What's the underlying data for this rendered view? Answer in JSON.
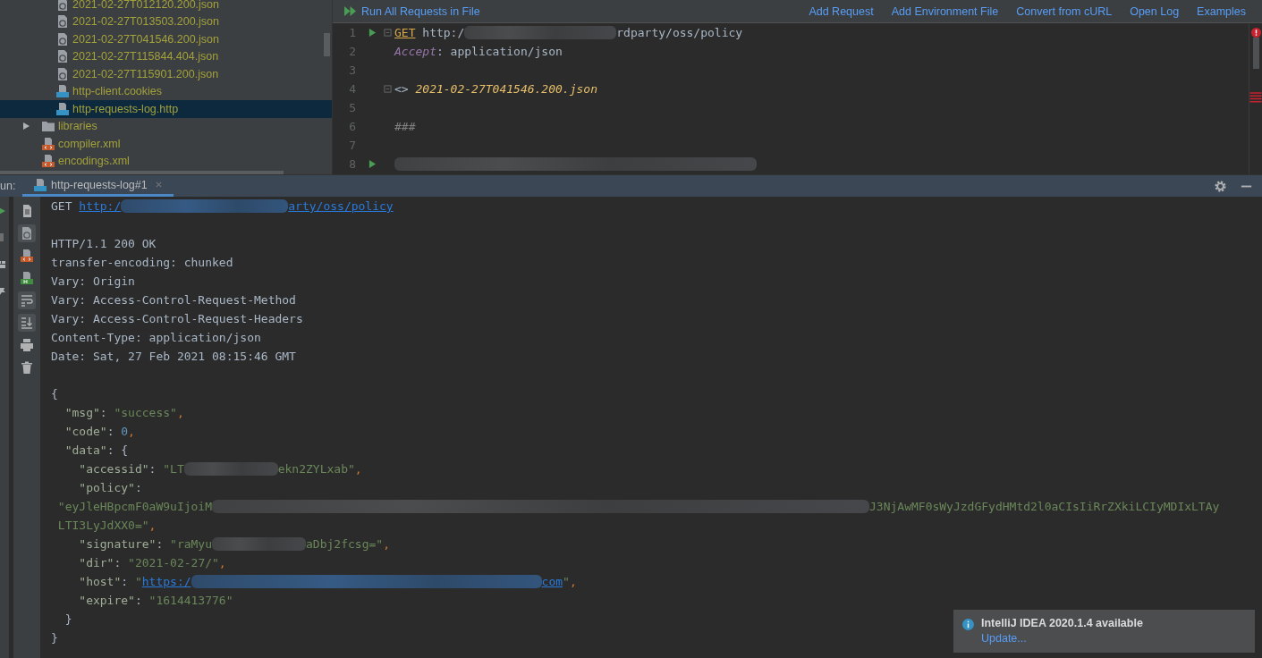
{
  "project_tree": {
    "items": [
      {
        "children": [
          {
            "label": "2021-02-27T012120.200.json",
            "kind": "json",
            "selected": false
          },
          {
            "label": "2021-02-27T013503.200.json",
            "kind": "json",
            "selected": false
          },
          {
            "label": "2021-02-27T041546.200.json",
            "kind": "json",
            "selected": false
          },
          {
            "label": "2021-02-27T115844.404.json",
            "kind": "json",
            "selected": false
          },
          {
            "label": "2021-02-27T115901.200.json",
            "kind": "json",
            "selected": false
          },
          {
            "label": "http-client.cookies",
            "kind": "api",
            "selected": false
          },
          {
            "label": "http-requests-log.http",
            "kind": "api",
            "selected": true
          }
        ]
      },
      {
        "label": "libraries",
        "kind": "folder",
        "expanded": false,
        "selected": false
      },
      {
        "label": "compiler.xml",
        "kind": "xml",
        "selected": false
      },
      {
        "label": "encodings.xml",
        "kind": "xml",
        "selected": false
      }
    ]
  },
  "editor": {
    "toolbar": {
      "run_all": "Run All Requests in File",
      "actions": [
        "Add Request",
        "Add Environment File",
        "Convert from cURL",
        "Open Log",
        "Examples"
      ]
    },
    "lines": [
      {
        "number": "1",
        "run": true,
        "fold": true,
        "tokens": [
          {
            "kind": "method",
            "text": "GET"
          },
          {
            "kind": "plain",
            "text": " http:/"
          },
          {
            "kind": "redacted"
          },
          {
            "kind": "plain",
            "text": "rdparty/oss/policy"
          }
        ]
      },
      {
        "number": "2",
        "run": false,
        "fold": false,
        "tokens": [
          {
            "kind": "header",
            "text": "Accept"
          },
          {
            "kind": "plain",
            "text": ": application/json"
          }
        ]
      },
      {
        "number": "3",
        "run": false,
        "fold": false
      },
      {
        "number": "4",
        "run": false,
        "fold": true,
        "tokens": [
          {
            "kind": "plain",
            "text": "<> "
          },
          {
            "kind": "ref",
            "text": "2021-02-27T041546.200.json"
          }
        ]
      },
      {
        "number": "5",
        "run": false,
        "fold": false
      },
      {
        "number": "6",
        "run": false,
        "fold": false,
        "tokens": [
          {
            "kind": "separator",
            "text": "###"
          }
        ]
      },
      {
        "number": "7",
        "run": false,
        "fold": false
      },
      {
        "number": "8",
        "run": true,
        "fold": false,
        "tokens": [
          {
            "kind": "redacted"
          }
        ]
      }
    ]
  },
  "run_panel": {
    "label": "un:",
    "tab": {
      "label": "http-requests-log#1",
      "selected": true
    },
    "output": [
      {
        "tokens": [
          {
            "kind": "plain",
            "text": "GET "
          },
          {
            "kind": "link",
            "text": "http:/"
          },
          {
            "kind": "redacted_link"
          },
          {
            "kind": "link",
            "text": "arty/oss/policy"
          }
        ]
      },
      {
        "kind": "blank"
      },
      {
        "tokens": [
          {
            "kind": "plain",
            "text": "HTTP/1.1 200 OK"
          }
        ]
      },
      {
        "tokens": [
          {
            "kind": "plain",
            "text": "transfer-encoding: chunked"
          }
        ]
      },
      {
        "tokens": [
          {
            "kind": "plain",
            "text": "Vary: Origin"
          }
        ]
      },
      {
        "tokens": [
          {
            "kind": "plain",
            "text": "Vary: Access-Control-Request-Method"
          }
        ]
      },
      {
        "tokens": [
          {
            "kind": "plain",
            "text": "Vary: Access-Control-Request-Headers"
          }
        ]
      },
      {
        "tokens": [
          {
            "kind": "plain",
            "text": "Content-Type: application/json"
          }
        ]
      },
      {
        "tokens": [
          {
            "kind": "plain",
            "text": "Date: Sat, 27 Feb 2021 08:15:46 GMT"
          }
        ]
      },
      {
        "kind": "blank"
      },
      {
        "tokens": [
          {
            "kind": "plain",
            "text": "{"
          }
        ]
      },
      {
        "tokens": [
          {
            "kind": "key",
            "text": "  \"msg\""
          },
          {
            "kind": "plain",
            "text": ": "
          },
          {
            "kind": "string",
            "text": "\"success\""
          },
          {
            "kind": "comma",
            "text": ","
          }
        ]
      },
      {
        "tokens": [
          {
            "kind": "key",
            "text": "  \"code\""
          },
          {
            "kind": "plain",
            "text": ": "
          },
          {
            "kind": "number",
            "text": "0"
          },
          {
            "kind": "comma",
            "text": ","
          }
        ]
      },
      {
        "tokens": [
          {
            "kind": "key",
            "text": "  \"data\""
          },
          {
            "kind": "plain",
            "text": ": {"
          }
        ]
      },
      {
        "tokens": [
          {
            "kind": "key",
            "text": "    \"accessid\""
          },
          {
            "kind": "plain",
            "text": ": "
          },
          {
            "kind": "string",
            "text": "\"LT"
          },
          {
            "kind": "redacted"
          },
          {
            "kind": "string",
            "text": "ekn2ZYLxab\""
          },
          {
            "kind": "comma",
            "text": ","
          }
        ]
      },
      {
        "tokens": [
          {
            "kind": "key",
            "text": "    \"policy\""
          },
          {
            "kind": "plain",
            "text": ":"
          }
        ]
      },
      {
        "tokens": [
          {
            "kind": "string",
            "text": " \"eyJleHBpcmF0aW9uIjoiM"
          },
          {
            "kind": "redacted_long"
          },
          {
            "kind": "string",
            "text": "J3NjAwMF0sWyJzdGFydHMtd2l0aCIsIiRrZXkiLCIyMDIxLTAy"
          }
        ]
      },
      {
        "tokens": [
          {
            "kind": "string",
            "text": " LTI3LyJdXX0=\""
          },
          {
            "kind": "comma",
            "text": ","
          }
        ]
      },
      {
        "tokens": [
          {
            "kind": "key",
            "text": "    \"signature\""
          },
          {
            "kind": "plain",
            "text": ": "
          },
          {
            "kind": "string",
            "text": "\"raMyu"
          },
          {
            "kind": "redacted"
          },
          {
            "kind": "string",
            "text": "aDbj2fcsg=\""
          },
          {
            "kind": "comma",
            "text": ","
          }
        ]
      },
      {
        "tokens": [
          {
            "kind": "key",
            "text": "    \"dir\""
          },
          {
            "kind": "plain",
            "text": ": "
          },
          {
            "kind": "string",
            "text": "\"2021-02-27/\""
          },
          {
            "kind": "comma",
            "text": ","
          }
        ]
      },
      {
        "tokens": [
          {
            "kind": "key",
            "text": "    \"host\""
          },
          {
            "kind": "plain",
            "text": ": "
          },
          {
            "kind": "string",
            "text": "\""
          },
          {
            "kind": "link",
            "text": "https:/"
          },
          {
            "kind": "redacted_link_long"
          },
          {
            "kind": "link",
            "text": "com"
          },
          {
            "kind": "string",
            "text": "\""
          },
          {
            "kind": "comma",
            "text": ","
          }
        ]
      },
      {
        "tokens": [
          {
            "kind": "key",
            "text": "    \"expire\""
          },
          {
            "kind": "plain",
            "text": ": "
          },
          {
            "kind": "string",
            "text": "\"1614413776\""
          }
        ]
      },
      {
        "tokens": [
          {
            "kind": "plain",
            "text": "  }"
          }
        ]
      },
      {
        "tokens": [
          {
            "kind": "plain",
            "text": "}"
          }
        ]
      }
    ]
  },
  "notification": {
    "title": "IntelliJ IDEA 2020.1.4 available",
    "link": "Update..."
  }
}
